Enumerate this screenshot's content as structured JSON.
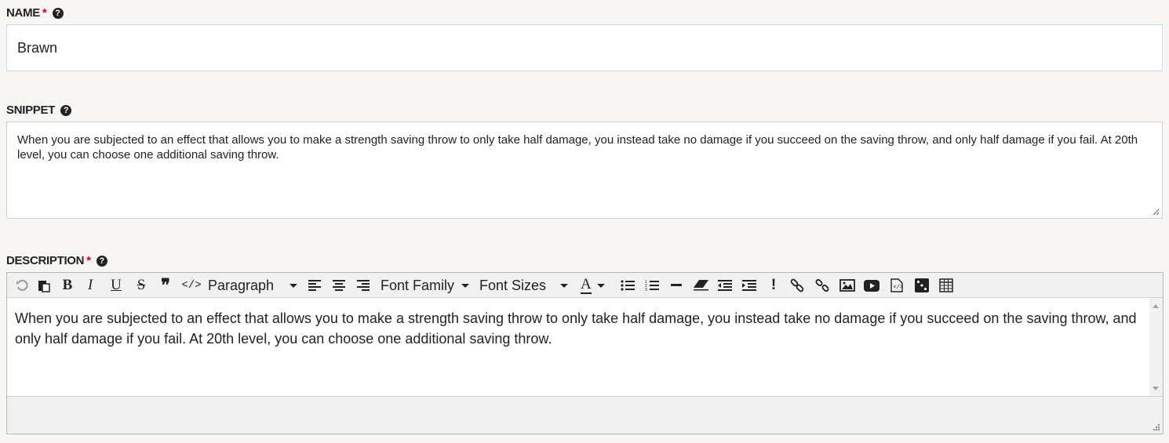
{
  "name_field": {
    "label": "NAME",
    "required_mark": "*",
    "help_icon": "question-circle-icon",
    "value": "Brawn"
  },
  "snippet_field": {
    "label": "SNIPPET",
    "help_icon": "question-circle-icon",
    "value": "When you are subjected to an effect that allows you to make a strength saving throw to only take half damage, you instead take no damage if you succeed on the saving throw, and only half damage if you fail. At 20th level, you can choose one additional saving throw."
  },
  "description_field": {
    "label": "DESCRIPTION",
    "required_mark": "*",
    "help_icon": "question-circle-icon",
    "toolbar": {
      "undo_icon": "undo-icon",
      "paste_icon": "paste-icon",
      "bold": "B",
      "italic": "I",
      "underline": "U",
      "strike": "S",
      "quote": "❞",
      "code": "</>",
      "block_format": "Paragraph",
      "font_family": "Font Family",
      "font_sizes": "Font Sizes",
      "text_color": "A",
      "excl": "!"
    },
    "content": "When you are subjected to an effect that allows you to make a strength saving throw to only take half damage, you instead take no damage if you succeed on the saving throw, and only half damage if you fail. At 20th level, you can choose one additional saving throw."
  },
  "colors": {
    "required": "#d0021b",
    "background": "#f7f6f3",
    "input_border": "#c9dbe4",
    "toolbar_bg": "#f1f1f1"
  }
}
